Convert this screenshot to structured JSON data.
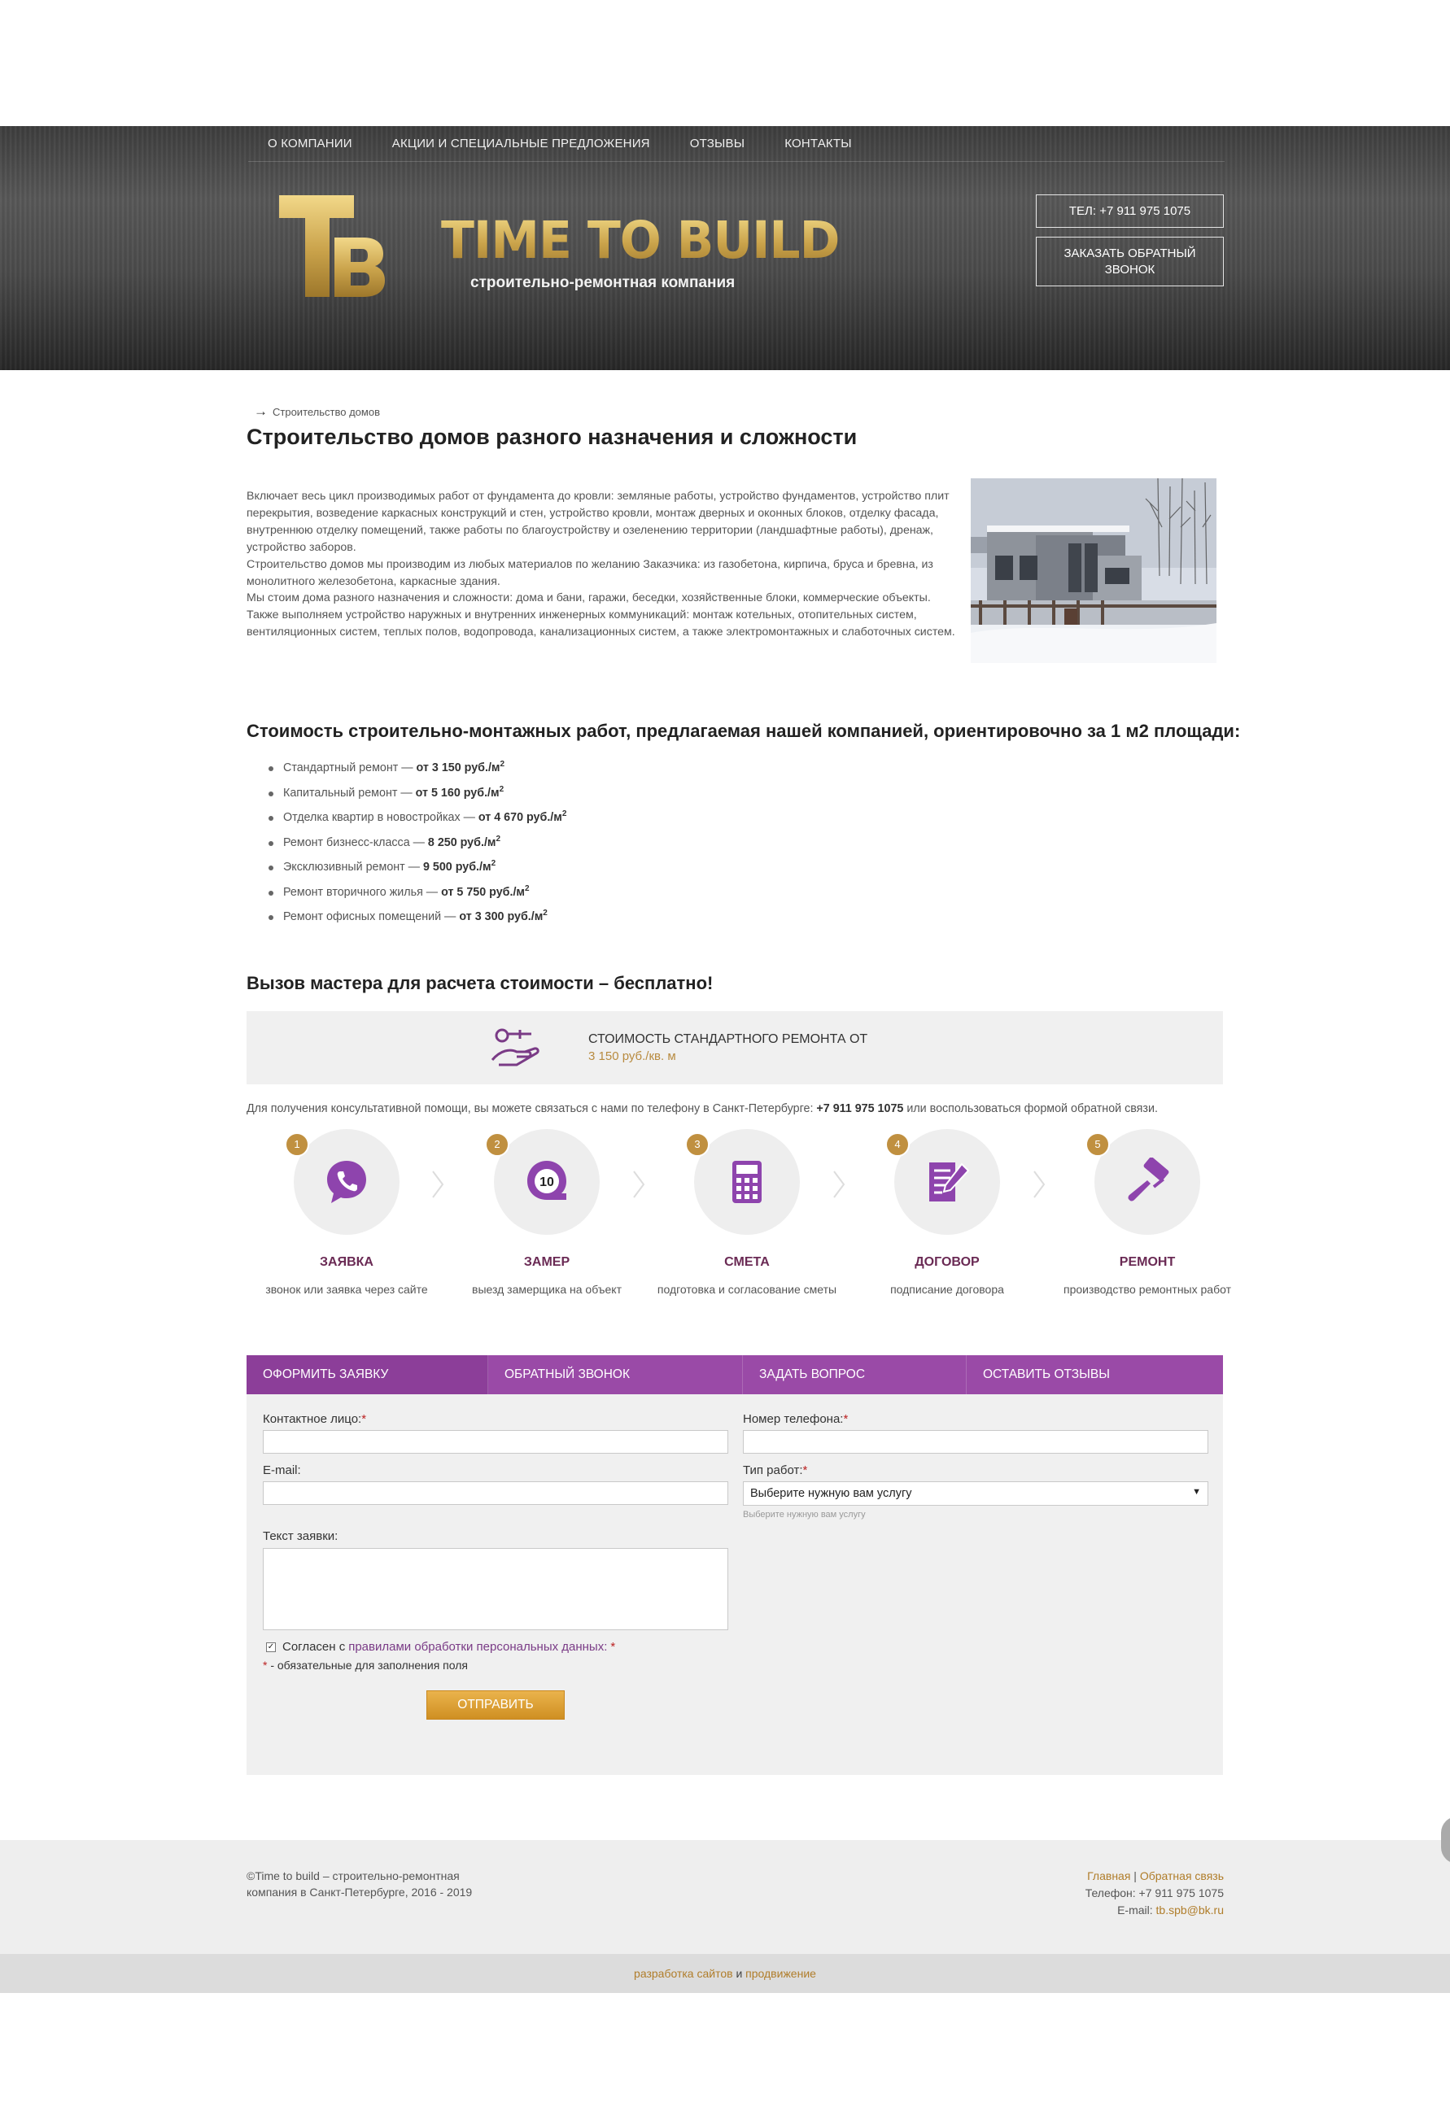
{
  "nav": [
    "О КОМПАНИИ",
    "АКЦИИ И СПЕЦИАЛЬНЫЕ ПРЕДЛОЖЕНИЯ",
    "ОТЗЫВЫ",
    "КОНТАКТЫ"
  ],
  "brand": {
    "mark": "TB",
    "name": "TIME TO BUILD",
    "tagline": "строительно-ремонтная компания",
    "gold": "#c9a24a"
  },
  "header_buttons": {
    "phone": "ТЕЛ: +7 911 975 1075",
    "callback": "ЗАКАЗАТЬ ОБРАТНЫЙ ЗВОНОК"
  },
  "breadcrumb": "Строительство домов",
  "page_title": "Строительство домов разного назначения и сложности",
  "intro": [
    "Включает весь цикл производимых работ от фундамента до кровли: земляные работы, устройство фундаментов, устройство плит перекрытия, возведение каркасных конструкций и стен, устройство кровли, монтаж дверных и оконных блоков, отделку фасада, внутреннюю отделку помещений, также работы по благоустройству и озеленению территории (ландшафтные работы), дренаж, устройство заборов.",
    "Строительство домов мы производим из любых материалов по желанию Заказчика: из газобетона, кирпича, бруса и бревна, из монолитного железобетона, каркасные здания.",
    "Мы стоим дома разного назначения и сложности: дома и бани, гаражи, беседки, хозяйственные блоки, коммерческие объекты.",
    "Также выполняем устройство наружных и внутренних инженерных коммуникаций: монтаж котельных, отопительных систем, вентиляционных систем, теплых полов, водопровода, канализационных систем, а также электромонтажных и слаботочных систем."
  ],
  "prices_title": "Стоимость строительно-монтажных работ, предлагаемая нашей компанией, ориентировочно за 1 м2 площади:",
  "prices": [
    {
      "name": "Стандартный ремонт — ",
      "value": "от 3 150 руб./м"
    },
    {
      "name": "Капитальный ремонт — ",
      "value": "от 5 160 руб./м"
    },
    {
      "name": "Отделка квартир в новостройках — ",
      "value": "от 4 670 руб./м"
    },
    {
      "name": "Ремонт бизнесс-класса — ",
      "value": "8 250 руб./м"
    },
    {
      "name": "Эксклюзивный ремонт — ",
      "value": "9 500 руб./м"
    },
    {
      "name": "Ремонт вторичного жилья — ",
      "value": "от 5 750 руб./м"
    },
    {
      "name": "Ремонт офисных помещений — ",
      "value": "от 3 300 руб./м"
    }
  ],
  "price_unit_sup": "2",
  "call_title": "Вызов мастера для расчета стоимости – бесплатно!",
  "cost_box": {
    "title": "СТОИМОСТЬ СТАНДАРТНОГО РЕМОНТА ОТ",
    "value": "3 150 руб./кв. м"
  },
  "consult": {
    "before": "Для получения консультативной помощи, вы можете связаться с нами по телефону в Санкт-Петербурге: ",
    "phone": "+7 911 975 1075",
    "after": " или воспользоваться формой обратной связи."
  },
  "steps": [
    {
      "num": "1",
      "label": "ЗАЯВКА",
      "desc": "звонок или заявка через сайте",
      "icon": "phone-icon"
    },
    {
      "num": "2",
      "label": "ЗАМЕР",
      "desc": "выезд замерщика на объект",
      "icon": "tape-measure-icon"
    },
    {
      "num": "3",
      "label": "СМЕТА",
      "desc": "подготовка и согласование сметы",
      "icon": "calculator-icon"
    },
    {
      "num": "4",
      "label": "ДОГОВОР",
      "desc": "подписание договора",
      "icon": "contract-icon"
    },
    {
      "num": "5",
      "label": "РЕМОНТ",
      "desc": "производство ремонтных работ",
      "icon": "paint-roller-icon"
    }
  ],
  "step_color": "#8e44ad",
  "form": {
    "tabs": [
      "ОФОРМИТЬ ЗАЯВКУ",
      "ОБРАТНЫЙ ЗВОНОК",
      "ЗАДАТЬ ВОПРОС",
      "ОСТАВИТЬ ОТЗЫВЫ"
    ],
    "contact_label": "Контактное лицо:",
    "phone_label": "Номер телефона:",
    "email_label": "E-mail:",
    "work_label": "Тип работ:",
    "work_selected": "Выберите нужную вам услугу",
    "work_hint": "Выберите нужную вам услугу",
    "text_label": "Текст заявки:",
    "agree_before": "Согласен с",
    "agree_link": "правилами обработки персональных данных:",
    "required_note": " - обязательные для заполнения поля",
    "required_mark": "*",
    "submit": "ОТПРАВИТЬ",
    "accent": "#9a4aa7"
  },
  "footer": {
    "copyright": "©Time to build – строительно-ремонтная компания в Санкт-Петербурге, 2016 - 2019",
    "link_home": "Главная",
    "link_sep": " | ",
    "link_feedback": "Обратная связь",
    "phone": "Телефон: +7 911 975 1075",
    "email_label": "E-mail: ",
    "email": "tb.spb@bk.ru",
    "dev_link1": "разработка сайтов",
    "dev_and": " и ",
    "dev_link2": "продвижение"
  }
}
